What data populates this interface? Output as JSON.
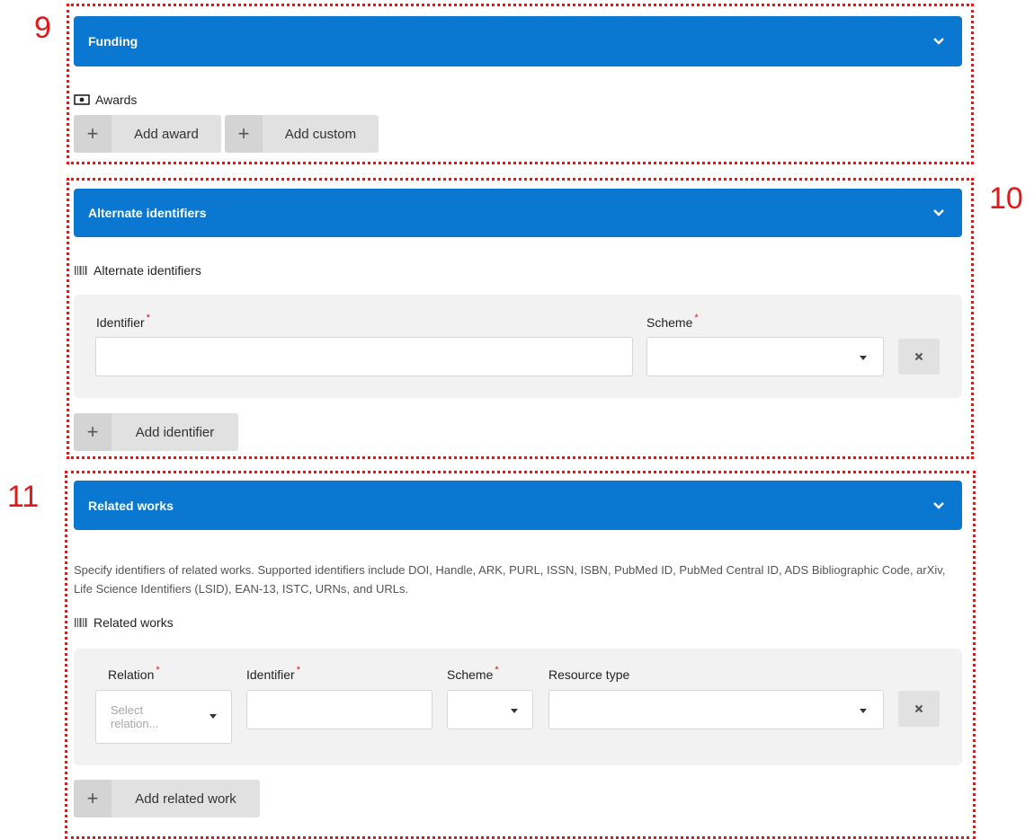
{
  "annotations": [
    "9",
    "10",
    "11"
  ],
  "funding": {
    "header": "Funding",
    "sublabel": "Awards",
    "add_award_label": "Add award",
    "add_custom_label": "Add custom"
  },
  "alternate_identifiers": {
    "header": "Alternate identifiers",
    "sublabel": "Alternate identifiers",
    "identifier_label": "Identifier",
    "scheme_label": "Scheme",
    "required_mark": "*",
    "identifier_value": "",
    "scheme_value": "",
    "add_button_label": "Add identifier"
  },
  "related_works": {
    "header": "Related works",
    "description": "Specify identifiers of related works. Supported identifiers include DOI, Handle, ARK, PURL, ISSN, ISBN, PubMed ID, PubMed Central ID, ADS Bibliographic Code, arXiv, Life Science Identifiers (LSID), EAN-13, ISTC, URNs, and URLs.",
    "sublabel": "Related works",
    "relation_label": "Relation",
    "identifier_label": "Identifier",
    "scheme_label": "Scheme",
    "resource_type_label": "Resource type",
    "required_mark": "*",
    "relation_placeholder": "Select relation...",
    "add_button_label": "Add related work"
  },
  "colors": {
    "header_bg": "#0a78d0",
    "annotation": "#e0191b",
    "required": "#d0161b"
  },
  "icons": [
    "chevron-down-icon",
    "money-icon",
    "barcode-icon",
    "plus-icon",
    "close-icon",
    "dropdown-caret-icon"
  ]
}
